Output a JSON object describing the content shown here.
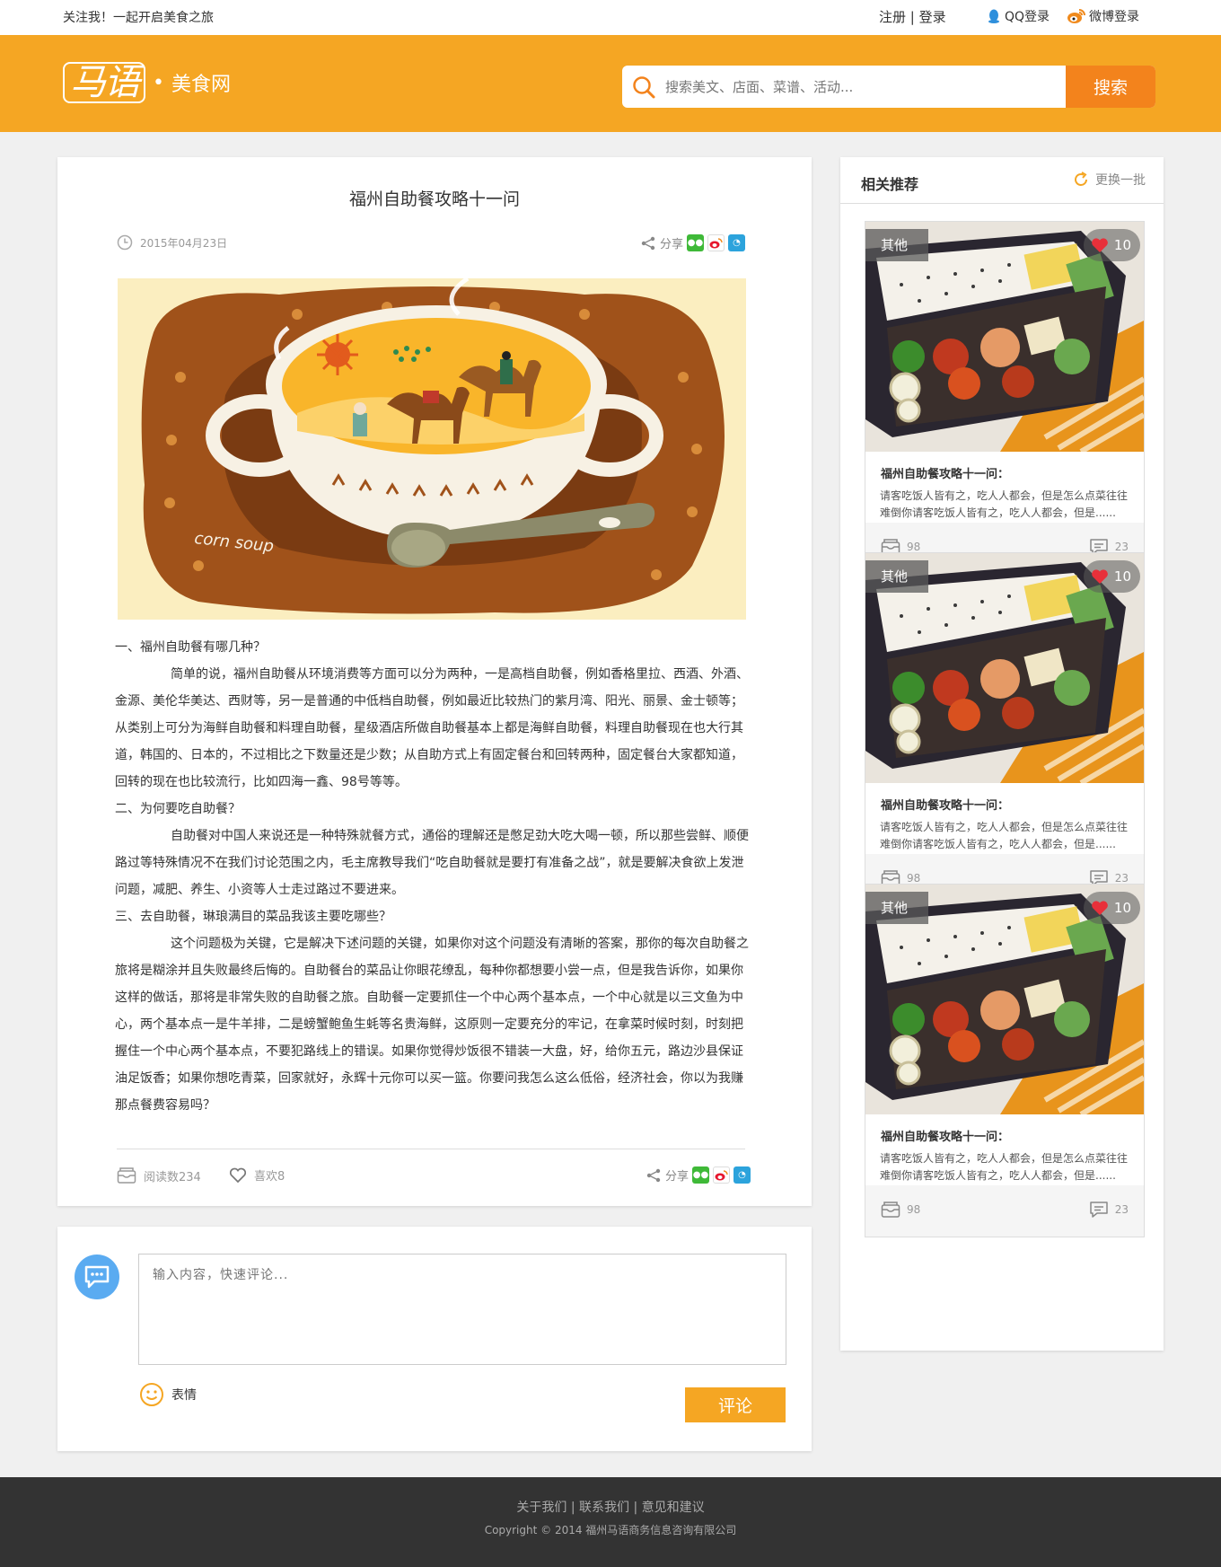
{
  "topbar": {
    "slogan": "关注我！一起开启美食之旅",
    "register": "注册",
    "divider": "|",
    "login": "登录",
    "qq_login": "QQ登录",
    "weibo_login": "微博登录"
  },
  "header": {
    "logo_brand": "马语",
    "logo_dot": "•",
    "logo_site": "美食网",
    "search_placeholder": "搜索美文、店面、菜谱、活动...",
    "search_button": "搜索"
  },
  "article": {
    "title": "福州自助餐攻略十一问",
    "date": "2015年04月23日",
    "share_label": "分享",
    "image_caption": "corn soup",
    "paragraphs": [
      {
        "type": "h",
        "text": "一、福州自助餐有哪几种？"
      },
      {
        "type": "p",
        "text": "简单的说，福州自助餐从环境消费等方面可以分为两种，一是高档自助餐，例如香格里拉、西酒、外酒、金源、美伦华美达、西财等，另一是普通的中低档自助餐，例如最近比较热门的紫月湾、阳光、丽景、金士顿等；从类别上可分为海鲜自助餐和料理自助餐，星级酒店所做自助餐基本上都是海鲜自助餐，料理自助餐现在也大行其道，韩国的、日本的，不过相比之下数量还是少数；从自助方式上有固定餐台和回转两种，固定餐台大家都知道，回转的现在也比较流行，比如四海一鑫、98号等等。"
      },
      {
        "type": "h",
        "text": "二、为何要吃自助餐？"
      },
      {
        "type": "p",
        "text": "自助餐对中国人来说还是一种特殊就餐方式，通俗的理解还是憋足劲大吃大喝一顿，所以那些尝鲜、顺便路过等特殊情况不在我们讨论范围之内，毛主席教导我们“吃自助餐就是要打有准备之战”，就是要解决食欲上发泄问题，减肥、养生、小资等人士走过路过不要进来。"
      },
      {
        "type": "h",
        "text": "三、去自助餐，琳琅满目的菜品我该主要吃哪些？"
      },
      {
        "type": "p",
        "text": "这个问题极为关键，它是解决下述问题的关键，如果你对这个问题没有清晰的答案，那你的每次自助餐之旅将是糊涂并且失败最终后悔的。自助餐台的菜品让你眼花缭乱，每种你都想要小尝一点，但是我告诉你，如果你这样的做话，那将是非常失败的自助餐之旅。自助餐一定要抓住一个中心两个基本点，一个中心就是以三文鱼为中心，两个基本点一是牛羊排，二是螃蟹鲍鱼生蚝等名贵海鲜，这原则一定要充分的牢记，在拿菜时候时刻，时刻把握住一个中心两个基本点，不要犯路线上的错误。如果你觉得炒饭很不错装一大盘，好，给你五元，路边沙县保证油足饭香；如果你想吃青菜，回家就好，永辉十元你可以买一篮。你要问我怎么这么低俗，经济社会，你以为我赚那点餐费容易吗？"
      }
    ],
    "reads": "阅读数234",
    "likes": "喜欢8"
  },
  "comment": {
    "placeholder": "输入内容，快速评论...",
    "emoji_label": "表情",
    "submit": "评论"
  },
  "sidebar": {
    "title": "相关推荐",
    "refresh": "更换一批",
    "cards": [
      {
        "tag": "其他",
        "likes": "10",
        "title": "福州自助餐攻略十一问：",
        "desc": "请客吃饭人皆有之，吃人人都会，但是怎么点菜往往难倒你请客吃饭人皆有之，吃人人都会，但是......",
        "reads": "98",
        "comments": "23"
      },
      {
        "tag": "其他",
        "likes": "10",
        "title": "福州自助餐攻略十一问：",
        "desc": "请客吃饭人皆有之，吃人人都会，但是怎么点菜往往难倒你请客吃饭人皆有之，吃人人都会，但是......",
        "reads": "98",
        "comments": "23"
      },
      {
        "tag": "其他",
        "likes": "10",
        "title": "福州自助餐攻略十一问：",
        "desc": "请客吃饭人皆有之，吃人人都会，但是怎么点菜往往难倒你请客吃饭人皆有之，吃人人都会，但是......",
        "reads": "98",
        "comments": "23"
      }
    ]
  },
  "footer": {
    "links": "关于我们 | 联系我们 | 意见和建议",
    "copyright": "Copyright © 2014 福州马语商务信息咨询有限公司"
  },
  "colors": {
    "brand_orange": "#f5a623",
    "search_button": "#f3831c",
    "footer_bg": "#333333"
  }
}
